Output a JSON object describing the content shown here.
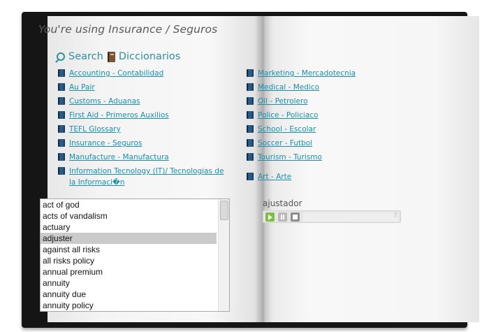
{
  "header": {
    "title": "You're using Insurance / Seguros"
  },
  "nav": {
    "search_label": "Search",
    "dictionaries_label": "Diccionarios"
  },
  "left_links": [
    "Accounting - Contabilidad",
    "Au Pair",
    "Customs - Aduanas",
    "First Aid - Primeros Auxilios",
    "TEFL Glossary",
    "Insurance - Seguros",
    "Manufacture - Manufactura",
    "Information Tecnology (IT)/ Tecnologias de la Informaci�n"
  ],
  "right_links": [
    "Marketing - Mercadotecnia",
    "Medical - Medico",
    "Oil - Petrolero",
    "Police - Policiaco",
    "School - Escolar",
    "Soccer - Futbol",
    "Tourism - Turismo",
    "Art - Arte"
  ],
  "term_list": {
    "items": [
      "act of god",
      "acts of vandalism",
      "actuary",
      "adjuster",
      "against all risks",
      "all risks policy",
      "annual premium",
      "annuity",
      "annuity due",
      "annuity policy"
    ],
    "selected": "adjuster"
  },
  "player": {
    "word": "ajustador",
    "help_label": "?",
    "icons": [
      "play-icon",
      "pause-icon",
      "stop-icon"
    ],
    "accent_color": "#7fbf3f"
  },
  "colors": {
    "link": "#1c8dab",
    "search": "#2f8f9e",
    "book_frame": "#151515"
  }
}
